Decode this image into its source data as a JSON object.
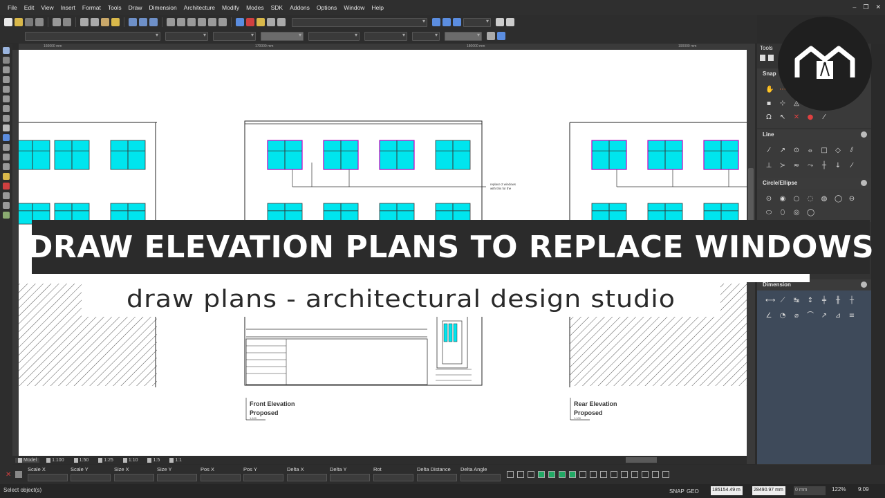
{
  "menu": [
    "File",
    "Edit",
    "View",
    "Insert",
    "Format",
    "Tools",
    "Draw",
    "Dimension",
    "Architecture",
    "Modify",
    "Modes",
    "SDK",
    "Addons",
    "Options",
    "Window",
    "Help"
  ],
  "window_controls": [
    "–",
    "❐",
    "✕"
  ],
  "ruler": {
    "marks": [
      "160000 mm",
      "170000 mm",
      "180000 mm",
      "190000 mm"
    ]
  },
  "drawing": {
    "note": "replace 2 windows\nwith this for the",
    "front_label": "Front Elevation",
    "front_sub": "Proposed",
    "rear_label": "Rear Elevation",
    "rear_sub": "Proposed",
    "scale_hint": "1:100"
  },
  "overlay": {
    "title": "DRAW ELEVATION PLANS TO REPLACE WINDOWS",
    "subtitle": "draw plans - architectural design studio"
  },
  "tabs": [
    "Model",
    "1:100",
    "1:50",
    "1:25",
    "1:10",
    "1:5",
    "1:1"
  ],
  "properties": [
    "Scale X",
    "Scale Y",
    "Size X",
    "Size Y",
    "Pos X",
    "Pos Y",
    "Delta X",
    "Delta Y",
    "Rot",
    "Delta Distance",
    "Delta Angle"
  ],
  "right_panel": {
    "tools_label": "Tools",
    "snap_label": "Snap",
    "sections": [
      "Line",
      "Circle/Ellipse",
      "Dimension"
    ]
  },
  "status": {
    "message": "Select object(s)",
    "snap": "SNAP",
    "geo": "GEO",
    "coord_x": "185154.49 m",
    "coord_y": "28490.97 mm",
    "zero": "0 mm",
    "zoom": "122%",
    "time": "9:09"
  },
  "colors": {
    "glass": "#00e5ee",
    "highlight": "#c000c0",
    "bg_dark": "#2b2b2b"
  }
}
